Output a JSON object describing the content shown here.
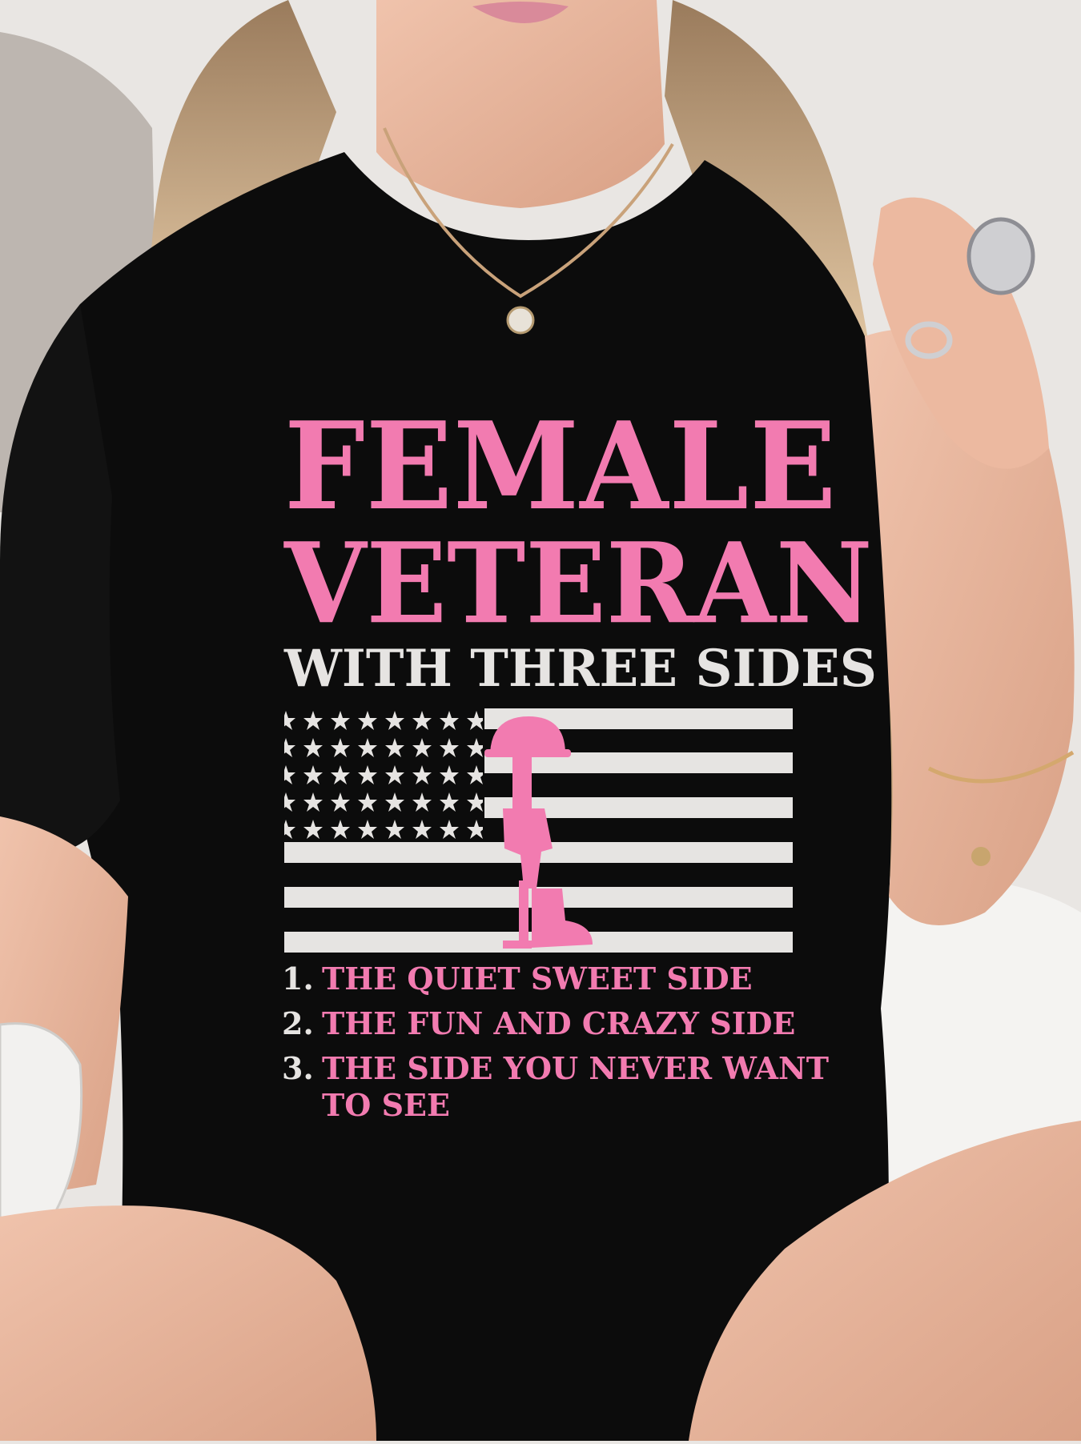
{
  "colors": {
    "background": "#e9e6e3",
    "skin": "#e7b8a0",
    "hair": "#d9bb95",
    "shirt": "#0c0c0c",
    "pink": "#f27bb0",
    "flag_white": "#e6e4e2"
  },
  "print": {
    "headline_line1": "FEMALE",
    "headline_line2": "VETERAN",
    "subheadline": "WITH THREE SIDES",
    "list": [
      {
        "number": "1.",
        "text": "THE QUIET SWEET SIDE"
      },
      {
        "number": "2.",
        "text": "THE FUN AND CRAZY SIDE"
      },
      {
        "number": "3.",
        "text": "THE SIDE YOU NEVER WANT\nTO SEE"
      }
    ]
  }
}
